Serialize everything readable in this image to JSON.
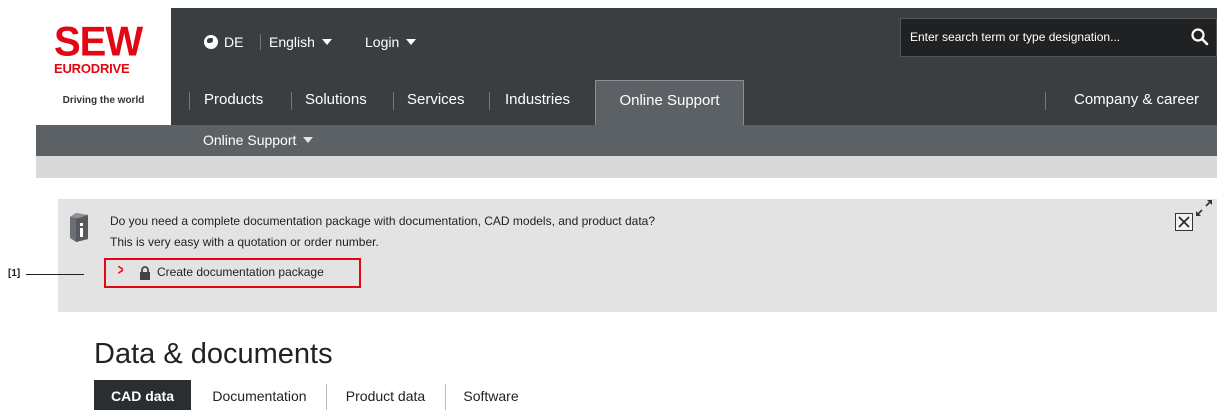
{
  "brand": {
    "logo_main": "SEW",
    "logo_sub": "EURODRIVE",
    "tagline": "Driving the world",
    "brand_color": "#e30613"
  },
  "topbar": {
    "region": "DE",
    "language": "English",
    "login": "Login"
  },
  "search": {
    "placeholder": "Enter search term or type designation..."
  },
  "mainnav": {
    "items": [
      "Products",
      "Solutions",
      "Services",
      "Industries",
      "Online Support"
    ],
    "active": "Online Support",
    "right_item": "Company & career"
  },
  "subnav": {
    "label": "Online Support"
  },
  "infobox": {
    "line1": "Do you need a complete documentation package with documentation, CAD models, and product data?",
    "line2": "This is very easy with a quotation or order number.",
    "link_chevron": ">",
    "link_label": "Create documentation package",
    "close_symbol": "×"
  },
  "callout": {
    "label": "[1]"
  },
  "section": {
    "title": "Data & documents",
    "tabs": [
      "CAD data",
      "Documentation",
      "Product data",
      "Software"
    ],
    "active_tab": "CAD data"
  },
  "colors": {
    "header_bg": "#3b3e41",
    "subnav_bg": "#5c6166",
    "infobox_bg": "#e3e3e3",
    "highlight": "#e30613"
  },
  "icons": [
    "globe-icon",
    "chevron-down-icon",
    "search-icon",
    "info-book-icon",
    "lock-icon",
    "close-icon",
    "expand-icon"
  ]
}
